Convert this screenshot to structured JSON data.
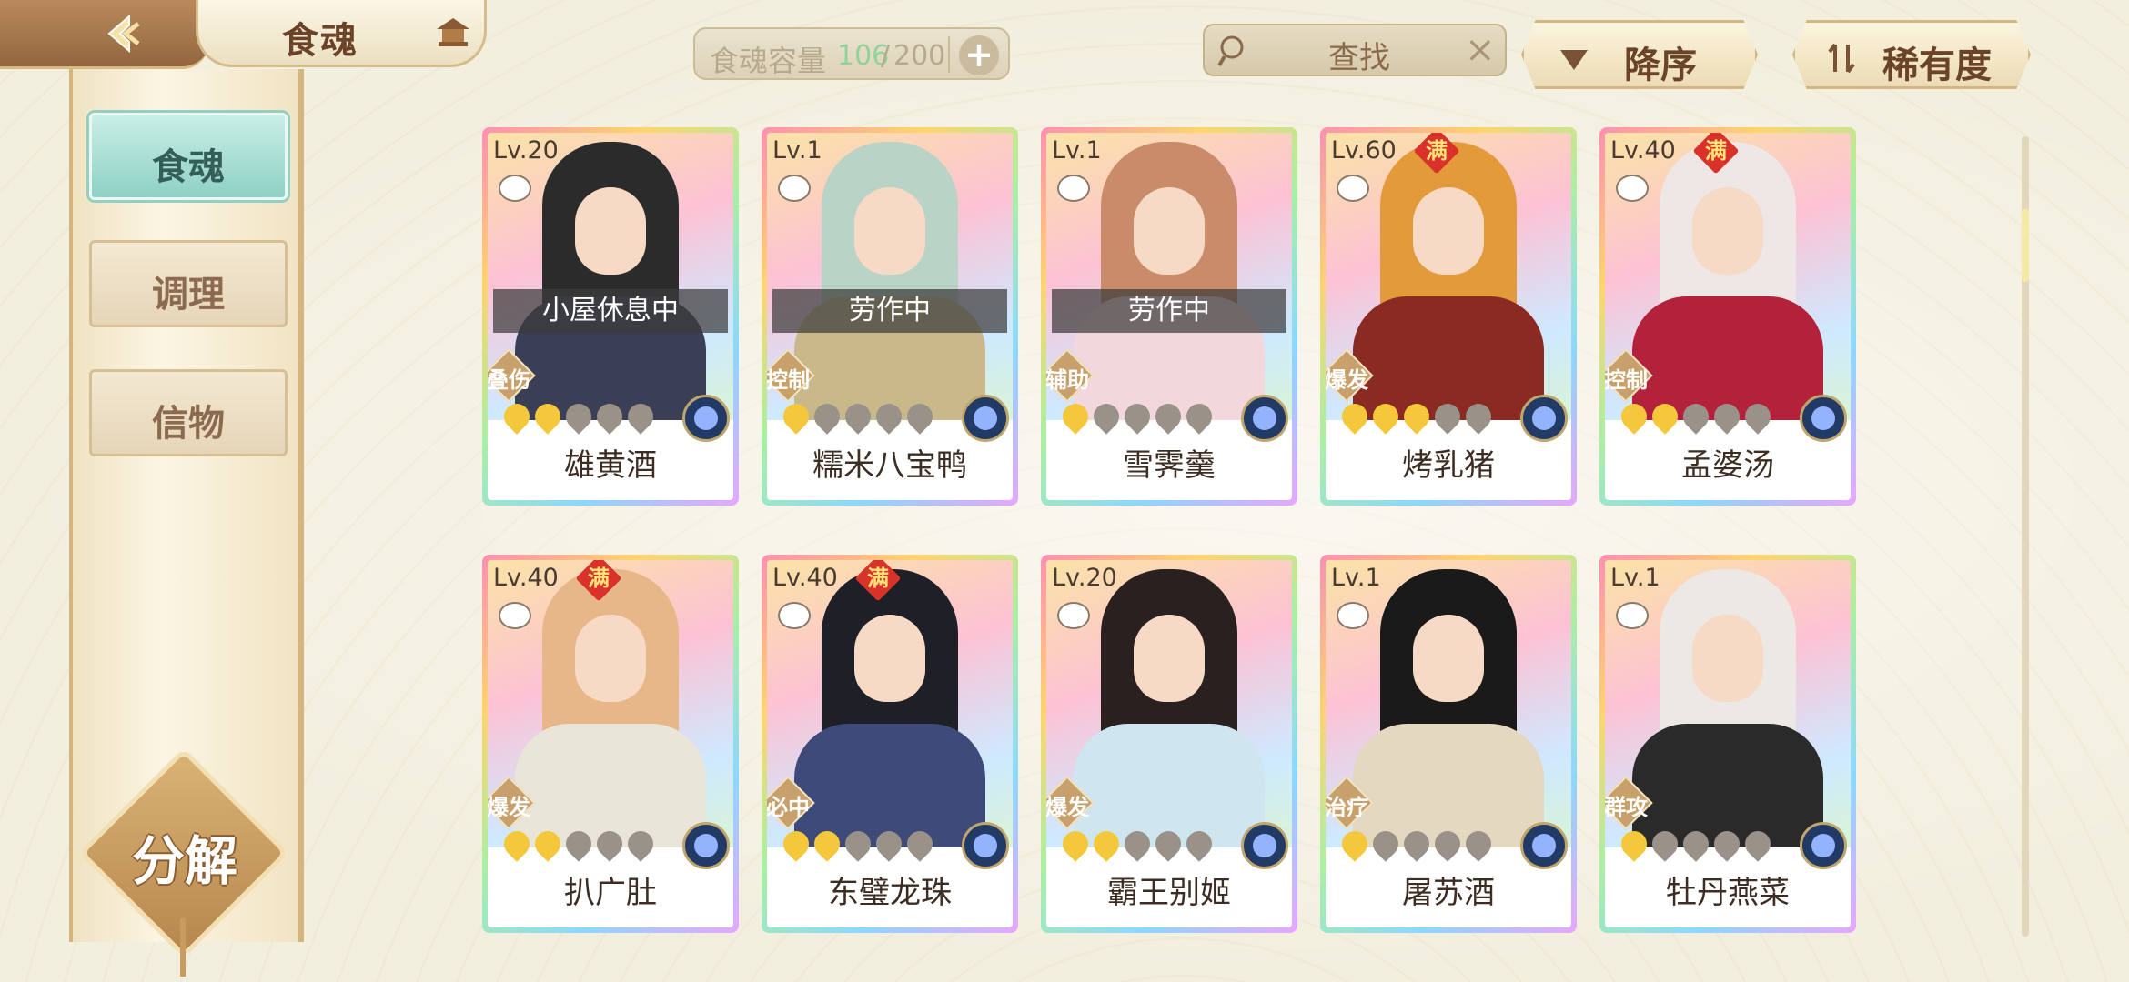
{
  "header": {
    "title": "食魂",
    "capacity_label": "食魂容量",
    "capacity_current": "106",
    "capacity_max": "200",
    "search_placeholder": "查找",
    "sort_order_label": "降序",
    "sort_by_label": "稀有度"
  },
  "sidebar": {
    "tabs": [
      {
        "label": "食魂",
        "active": true
      },
      {
        "label": "调理",
        "active": false
      },
      {
        "label": "信物",
        "active": false
      }
    ],
    "decompose_label": "分解"
  },
  "colors": {
    "accent_teal": "#8ed1c4",
    "gold": "#c8a06b",
    "capacity_green": "#8fd39a"
  },
  "cards": [
    {
      "level": "Lv.20",
      "name": "雄黄酒",
      "role": "叠伤",
      "status": "小屋休息中",
      "maxed": false,
      "stars": 2,
      "hair": "#2b2b2b",
      "robe": "#3b3f55"
    },
    {
      "level": "Lv.1",
      "name": "糯米八宝鸭",
      "role": "控制",
      "status": "劳作中",
      "maxed": false,
      "stars": 1,
      "hair": "#b9d3c7",
      "robe": "#c9b98a"
    },
    {
      "level": "Lv.1",
      "name": "雪霁羹",
      "role": "辅助",
      "status": "劳作中",
      "maxed": false,
      "stars": 1,
      "hair": "#c98b6a",
      "robe": "#f2d8dc"
    },
    {
      "level": "Lv.60",
      "name": "烤乳猪",
      "role": "爆发",
      "status": "",
      "maxed": true,
      "stars": 3,
      "hair": "#e39a3a",
      "robe": "#8a2a22"
    },
    {
      "level": "Lv.40",
      "name": "孟婆汤",
      "role": "控制",
      "status": "",
      "maxed": true,
      "stars": 2,
      "hair": "#efe6e6",
      "robe": "#b3213a"
    },
    {
      "level": "Lv.40",
      "name": "扒广肚",
      "role": "爆发",
      "status": "",
      "maxed": true,
      "stars": 2,
      "hair": "#e7b78a",
      "robe": "#e9e5d8"
    },
    {
      "level": "Lv.40",
      "name": "东璧龙珠",
      "role": "必中",
      "status": "",
      "maxed": true,
      "stars": 2,
      "hair": "#1f1f28",
      "robe": "#3d4a7a"
    },
    {
      "level": "Lv.20",
      "name": "霸王别姬",
      "role": "爆发",
      "status": "",
      "maxed": false,
      "stars": 2,
      "hair": "#2a2020",
      "robe": "#cfe6f0"
    },
    {
      "level": "Lv.1",
      "name": "屠苏酒",
      "role": "治疗",
      "status": "",
      "maxed": false,
      "stars": 1,
      "hair": "#1a1a1a",
      "robe": "#e4d8c0"
    },
    {
      "level": "Lv.1",
      "name": "牡丹燕菜",
      "role": "群攻",
      "status": "",
      "maxed": false,
      "stars": 1,
      "hair": "#ece8e4",
      "robe": "#2a2a2a"
    }
  ],
  "max_badge_text": "满",
  "total_flames": 5
}
